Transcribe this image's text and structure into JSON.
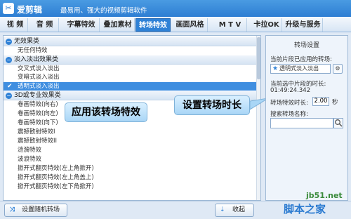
{
  "app": {
    "name": "爱剪辑",
    "slogan": "最易用、强大的视频剪辑软件"
  },
  "tabs": [
    {
      "label": "视 频"
    },
    {
      "label": "音 频"
    },
    {
      "label": "字幕特效"
    },
    {
      "label": "叠加素材"
    },
    {
      "label": "转场特效",
      "active": true
    },
    {
      "label": "画面风格"
    },
    {
      "label": "M T V"
    },
    {
      "label": "卡拉OK"
    },
    {
      "label": "升级与服务"
    }
  ],
  "effects": {
    "groups": [
      {
        "label": "无效果类",
        "items": [
          "无任何特效"
        ]
      },
      {
        "label": "淡入淡出效果类",
        "items": [
          "交叉式淡入淡出",
          "变暗式淡入淡出",
          "透明式淡入淡出"
        ]
      },
      {
        "label": "3D或专业效果类",
        "items": [
          "卷画特效(向右)",
          "卷画特效(向左)",
          "卷画特效(向下)",
          "震撼散射特效I",
          "震撼散射特效II",
          "涟漪特效",
          "波浪特效",
          "掀开式翻页特效(左上角掀开)",
          "掀开式翻页特效(左上角盖上)",
          "掀开式翻页特效(左下角掀开)"
        ]
      }
    ],
    "selected": "透明式淡入淡出"
  },
  "callouts": {
    "apply": "应用该转场特效",
    "set_duration": "设置转场时长"
  },
  "settings": {
    "title": "转场设置",
    "current_label": "当前片段已应用的转场:",
    "current_value": "透明式淡入淡出",
    "start_label": "当前选中片段的时长:",
    "start_value": "01:49:24.342",
    "duration_label": "转场特效时长:",
    "duration_value": "2.00",
    "duration_unit": "秒",
    "search_label": "搜索转场名称:",
    "search_placeholder": ""
  },
  "bottom": {
    "random_button": "设置随机转场",
    "collect_button": "收起"
  },
  "watermark": {
    "line1": "jb51.net",
    "line2": "脚本之家"
  },
  "colors": {
    "accent": "#2f81d6",
    "selected_row": "#3f8ee0"
  }
}
